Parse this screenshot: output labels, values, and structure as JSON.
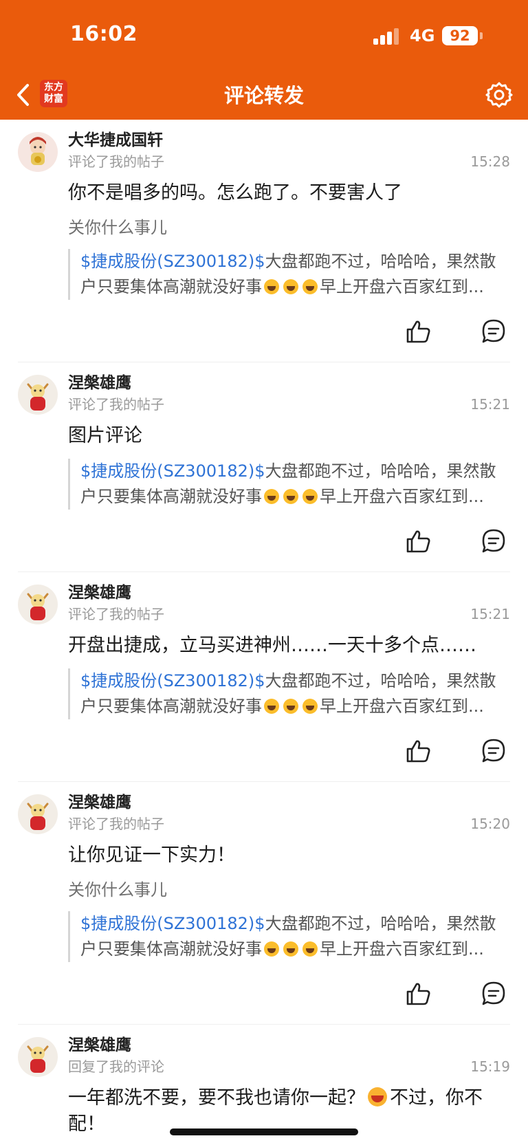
{
  "status_bar": {
    "time": "16:02",
    "network": "4G",
    "battery": "92"
  },
  "nav": {
    "title": "评论转发",
    "logo_text": "东方财富"
  },
  "colors": {
    "header": "#ea5b0c",
    "link": "#2f73d6"
  },
  "comments": [
    {
      "user": "大华捷成国轩",
      "action": "评论了我的帖子",
      "time": "15:28",
      "content": "你不是唱多的吗。怎么跑了。不要害人了",
      "reply": "关你什么事儿",
      "quote_tag": "$捷成股份(SZ300182)$",
      "quote_text_a": "大盘都跑不过，哈哈哈，果然散户只要集体高潮就没好事",
      "quote_text_b": "早上开盘六百家红到..."
    },
    {
      "user": "涅槃雄鹰",
      "action": "评论了我的帖子",
      "time": "15:21",
      "content": "图片评论",
      "quote_tag": "$捷成股份(SZ300182)$",
      "quote_text_a": "大盘都跑不过，哈哈哈，果然散户只要集体高潮就没好事",
      "quote_text_b": "早上开盘六百家红到..."
    },
    {
      "user": "涅槃雄鹰",
      "action": "评论了我的帖子",
      "time": "15:21",
      "content": "开盘出捷成，立马买进神州……一天十多个点……",
      "quote_tag": "$捷成股份(SZ300182)$",
      "quote_text_a": "大盘都跑不过，哈哈哈，果然散户只要集体高潮就没好事",
      "quote_text_b": "早上开盘六百家红到..."
    },
    {
      "user": "涅槃雄鹰",
      "action": "评论了我的帖子",
      "time": "15:20",
      "content": "让你见证一下实力！",
      "reply": "关你什么事儿",
      "quote_tag": "$捷成股份(SZ300182)$",
      "quote_text_a": "大盘都跑不过，哈哈哈，果然散户只要集体高潮就没好事",
      "quote_text_b": "早上开盘六百家红到..."
    },
    {
      "user": "涅槃雄鹰",
      "action": "回复了我的评论",
      "time": "15:19",
      "content_a": "一年都洗不要，要不我也请你一起？",
      "content_b": "不过，你不配！"
    }
  ]
}
